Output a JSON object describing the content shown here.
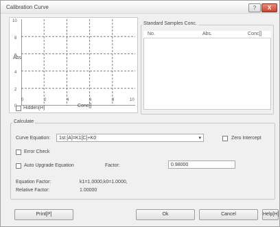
{
  "window": {
    "title": "Calibration Curve",
    "help_button": "?",
    "close_button": "X"
  },
  "chart_panel": {
    "y_axis_label": "Abs",
    "x_axis_label": "Conc[]",
    "y_ticks": [
      "10",
      "8",
      "6",
      "4",
      "2",
      "0"
    ],
    "x_ticks": [
      "0",
      "2",
      "4",
      "6",
      "8",
      "10"
    ],
    "hidden_checkbox_label": "Hidden[H]",
    "hidden_checked": false
  },
  "chart_data": {
    "type": "scatter",
    "xlim": [
      0,
      10
    ],
    "ylim": [
      0,
      10
    ],
    "grid": true,
    "series": []
  },
  "standard_samples": {
    "group_title": "Standard Samples Conc.",
    "columns": [
      "No.",
      "Abs.",
      "Conc[]"
    ],
    "rows": []
  },
  "calculate": {
    "group_title": "Calculate",
    "curve_equation_label": "Curve Equation:",
    "curve_equation_value": "1st [A]=K1[C]+K0",
    "zero_intercept_label": "Zero Intercept",
    "error_check_label": "Error Check",
    "auto_upgrade_label": "Auto Upgrade Equation",
    "factor_label": "Factor:",
    "factor_value": "0.98000",
    "equation_factor_label": "Equation Factor:",
    "equation_factor_value": "k1=1.0000,k0=1.0000,",
    "relative_factor_label": "Relative Factor:",
    "relative_factor_value": "1.00000"
  },
  "buttons": {
    "print": "Print[P]",
    "ok": "Ok",
    "cancel": "Cancel",
    "help": "Help[H]"
  }
}
